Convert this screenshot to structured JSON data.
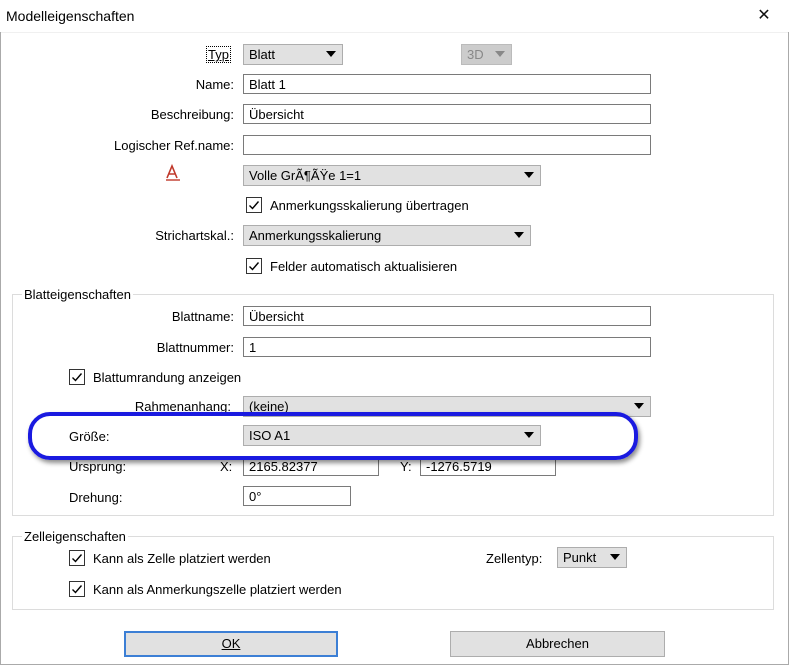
{
  "window": {
    "title": "Modelleigenschaften",
    "close": "✕"
  },
  "fields": {
    "typ_label": "Typ",
    "typ_value": "Blatt",
    "mode_value": "3D",
    "name_label": "Name:",
    "name_value": "Blatt 1",
    "beschreibung_label": "Beschreibung:",
    "beschreibung_value": "Übersicht",
    "logref_label": "Logischer Ref.name:",
    "logref_value": "",
    "scale_value": "Volle GrÃ¶ÃŸe 1=1",
    "anno_scale_check": "Anmerkungsskalierung übertragen",
    "strichart_label": "Strichartskal.:",
    "strichart_value": "Anmerkungsskalierung",
    "auto_fields_check": "Felder automatisch aktualisieren"
  },
  "blatt": {
    "group_title": "Blatteigenschaften",
    "blattname_label": "Blattname:",
    "blattname_value": "Übersicht",
    "blattnummer_label": "Blattnummer:",
    "blattnummer_value": "1",
    "border_check": "Blattumrandung anzeigen",
    "rahmen_label": "Rahmenanhang:",
    "rahmen_value": "(keine)",
    "groesse_label": "Größe:",
    "groesse_value": "ISO A1",
    "ursprung_label": "Ursprung:",
    "x_label": "X:",
    "x_value": "2165.82377",
    "y_label": "Y:",
    "y_value": "-1276.5719",
    "drehung_label": "Drehung:",
    "drehung_value": "0°"
  },
  "zelle": {
    "group_title": "Zelleigenschaften",
    "cell_check": "Kann als Zelle platziert werden",
    "anno_cell_check": "Kann als Anmerkungszelle platziert werden",
    "zellentyp_label": "Zellentyp:",
    "zellentyp_value": "Punkt"
  },
  "buttons": {
    "ok": "OK",
    "cancel": "Abbrechen"
  },
  "colors": {
    "highlight": "#1a1ae0",
    "default_button_border": "#3c7fd5",
    "annotation_icon": "#c0392b"
  }
}
